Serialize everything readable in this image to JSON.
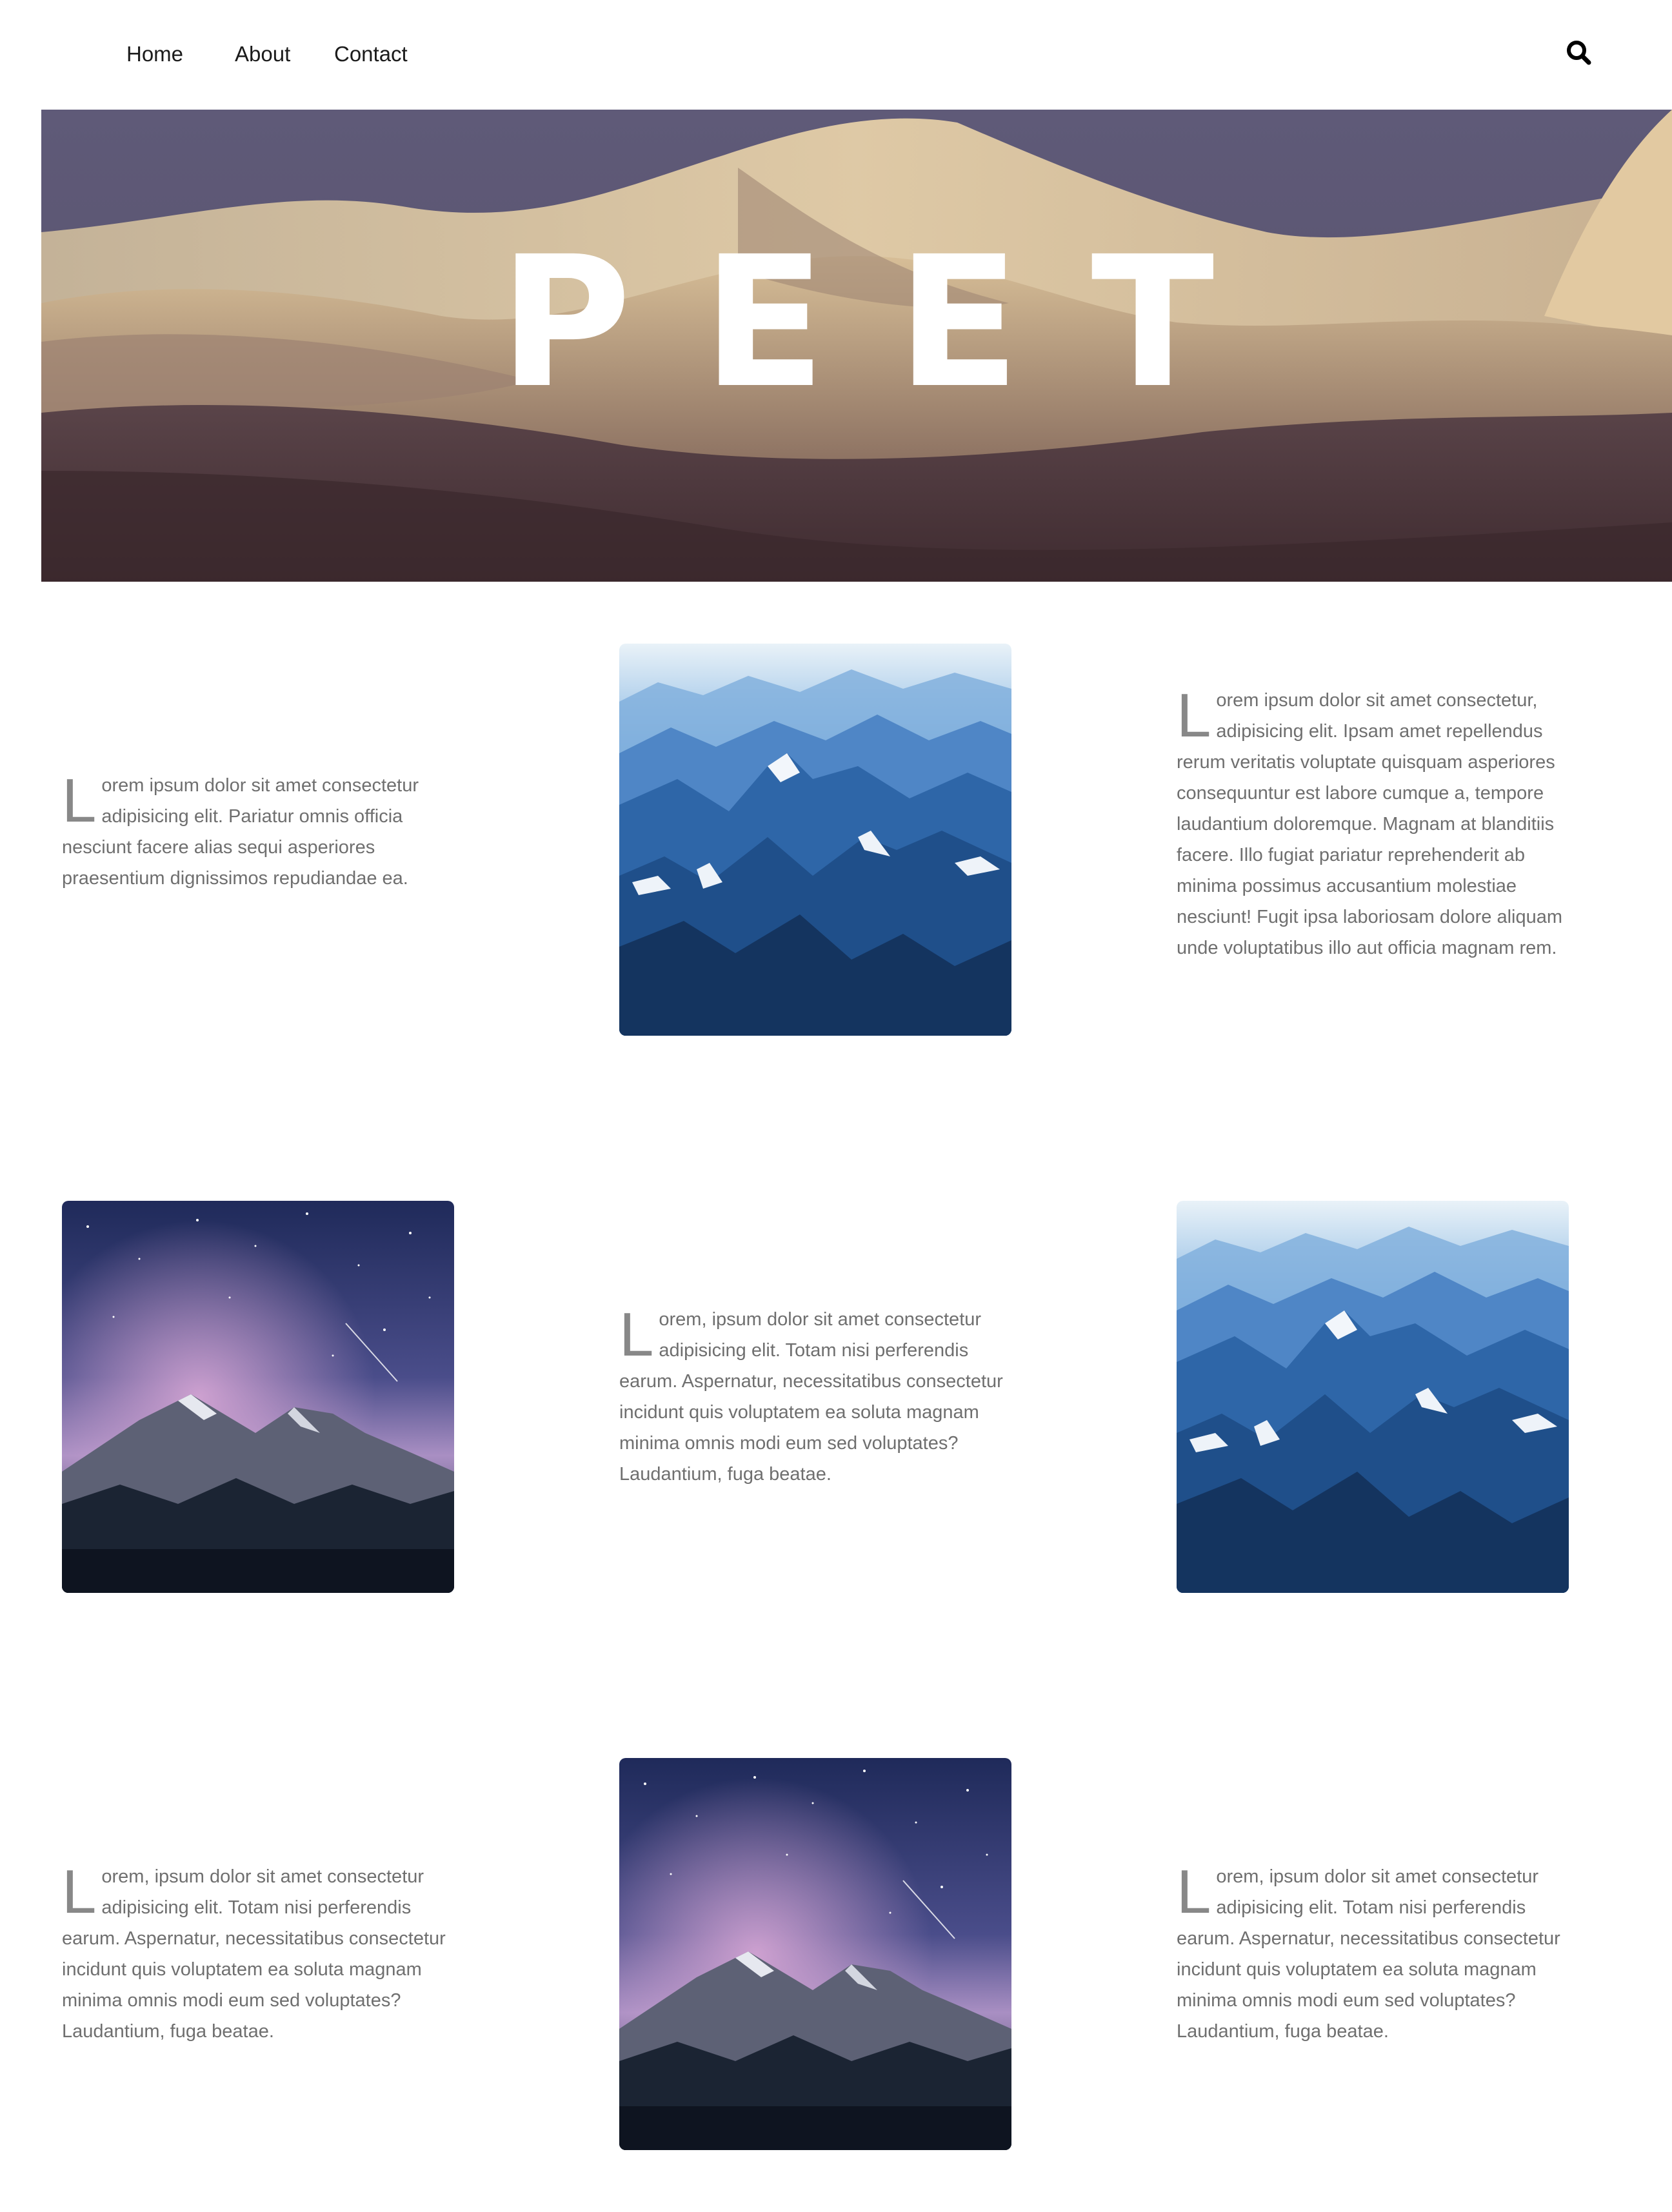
{
  "nav": {
    "links": [
      "Home",
      "About",
      "Contact"
    ]
  },
  "icons": {
    "search": "search-icon"
  },
  "hero": {
    "title": "PEET"
  },
  "sections": [
    {
      "drop": "L",
      "text": "orem ipsum dolor sit amet consectetur adipisicing elit. Pariatur omnis officia nesciunt facere alias sequi asperiores praesentium dignissimos repudiandae ea."
    },
    {
      "drop": "L",
      "text": "orem ipsum dolor sit amet consectetur, adipisicing elit. Ipsam amet repellendus rerum veritatis voluptate quisquam asperiores consequuntur est labore cumque a, tempore laudantium doloremque. Magnam at blanditiis facere. Illo fugiat pariatur reprehenderit ab minima possimus accusantium molestiae nesciunt! Fugit ipsa laboriosam dolore aliquam unde voluptatibus illo aut officia magnam rem."
    },
    {
      "drop": "L",
      "text": "orem, ipsum dolor sit amet consectetur adipisicing elit. Totam nisi perferendis earum. Aspernatur, necessitatibus consectetur incidunt quis voluptatem ea soluta magnam minima omnis modi eum sed voluptates? Laudantium, fuga beatae."
    },
    {
      "drop": "L",
      "text": "orem, ipsum dolor sit amet consectetur adipisicing elit. Totam nisi perferendis earum. Aspernatur, necessitatibus consectetur incidunt quis voluptatem ea soluta magnam minima omnis modi eum sed voluptates? Laudantium, fuga beatae."
    },
    {
      "drop": "L",
      "text": "orem, ipsum dolor sit amet consectetur adipisicing elit. Totam nisi perferendis earum. Aspernatur, necessitatibus consectetur incidunt quis voluptatem ea soluta magnam minima omnis modi eum sed voluptates? Laudantium, fuga beatae."
    }
  ],
  "images": {
    "mountains": "blue-mountain-range-photo",
    "starry": "starry-night-mountain-photo"
  },
  "colors": {
    "nav_text": "#1b1b1b",
    "body_text": "#6f6f6f",
    "drop_cap": "#888888",
    "hero_title": "#ffffff"
  }
}
